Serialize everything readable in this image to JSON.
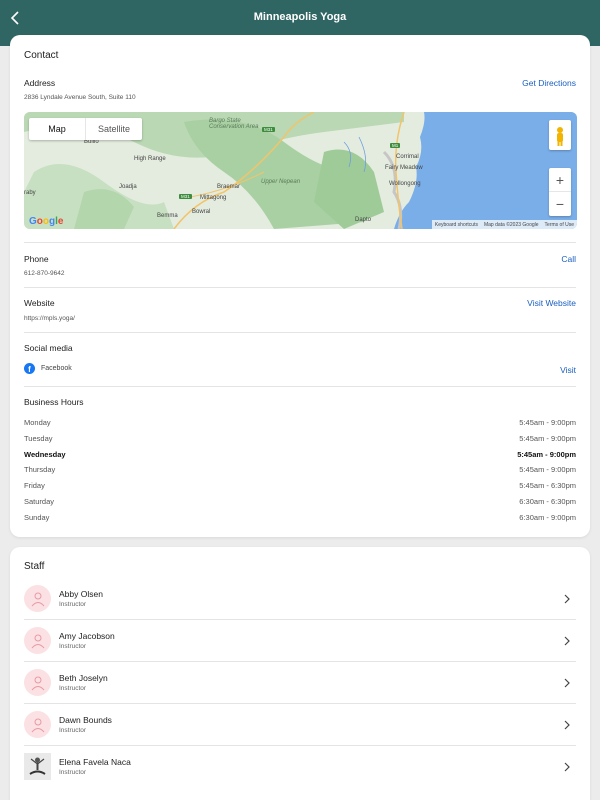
{
  "header": {
    "title": "Minneapolis Yoga",
    "back_icon": "chevron-left-icon"
  },
  "contact": {
    "title": "Contact",
    "address": {
      "label": "Address",
      "value": "2836 Lyndale Avenue South, Suite 110",
      "action": "Get Directions"
    },
    "map": {
      "map_tab": "Map",
      "satellite_tab": "Satellite",
      "zoom_in": "+",
      "zoom_out": "−",
      "logo": "Google",
      "keyboard": "Keyboard shortcuts",
      "map_data": "Map data ©2023 Google",
      "terms": "Terms of Use",
      "places": {
        "bargo": "Bargo State Conservation Area",
        "bullio": "Bullio",
        "high_range": "High Range",
        "joadja": "Joadja",
        "braemar": "Braemar",
        "mittagong": "Mittagong",
        "bowral": "Bowral",
        "bemma": "Bemma",
        "upper_nepean": "Upper Nepean",
        "corrimal": "Corrimal",
        "fairy_meadow": "Fairy Meadow",
        "wollongong": "Wollongong",
        "dapto": "Dapto",
        "raby": "raby"
      },
      "roads": {
        "m31a": "M31",
        "m31b": "M31",
        "m1": "M1"
      }
    },
    "phone": {
      "label": "Phone",
      "value": "612-870-9642",
      "action": "Call"
    },
    "website": {
      "label": "Website",
      "value": "https://mpls.yoga/",
      "action": "Visit Website"
    },
    "social": {
      "label": "Social media",
      "network": "Facebook",
      "action": "Visit",
      "icon": "facebook-icon"
    },
    "hours": {
      "label": "Business Hours",
      "rows": [
        {
          "day": "Monday",
          "time": "5:45am - 9:00pm"
        },
        {
          "day": "Tuesday",
          "time": "5:45am - 9:00pm"
        },
        {
          "day": "Wednesday",
          "time": "5:45am - 9:00pm"
        },
        {
          "day": "Thursday",
          "time": "5:45am - 9:00pm"
        },
        {
          "day": "Friday",
          "time": "5:45am - 6:30pm"
        },
        {
          "day": "Saturday",
          "time": "6:30am - 6:30pm"
        },
        {
          "day": "Sunday",
          "time": "6:30am - 9:00pm"
        }
      ]
    }
  },
  "staff": {
    "title": "Staff",
    "members": [
      {
        "name": "Abby Olsen",
        "role": "Instructor"
      },
      {
        "name": "Amy Jacobson",
        "role": "Instructor"
      },
      {
        "name": "Beth Joselyn",
        "role": "Instructor"
      },
      {
        "name": "Dawn Bounds",
        "role": "Instructor"
      },
      {
        "name": "Elena Favela Naca",
        "role": "Instructor"
      }
    ]
  },
  "colors": {
    "header": "#2f6663",
    "link": "#1a5fc0",
    "avatar_bg": "#fbe1e3",
    "facebook": "#1877f2"
  }
}
